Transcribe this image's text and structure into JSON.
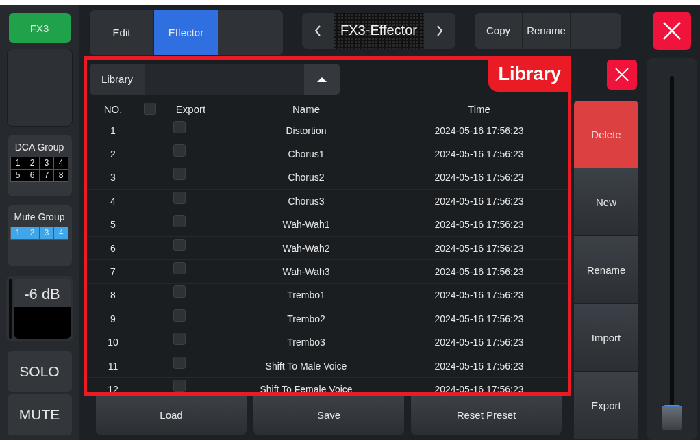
{
  "channel": {
    "label": "FX3"
  },
  "tabs": [
    {
      "label": "Edit",
      "selected": false
    },
    {
      "label": "Effector",
      "selected": true
    }
  ],
  "preset": {
    "title": "FX3-Effector"
  },
  "preset_actions": [
    "Copy",
    "Rename"
  ],
  "dca_group": {
    "title": "DCA Group",
    "cells": [
      {
        "label": "1",
        "on": false
      },
      {
        "label": "2",
        "on": false
      },
      {
        "label": "3",
        "on": false
      },
      {
        "label": "4",
        "on": false
      },
      {
        "label": "5",
        "on": false
      },
      {
        "label": "6",
        "on": false
      },
      {
        "label": "7",
        "on": false
      },
      {
        "label": "8",
        "on": false
      }
    ]
  },
  "mute_group": {
    "title": "Mute Group",
    "cells": [
      {
        "label": "1",
        "on": true
      },
      {
        "label": "2",
        "on": true
      },
      {
        "label": "3",
        "on": true
      },
      {
        "label": "4",
        "on": true
      }
    ]
  },
  "gain": {
    "reading": "-6 dB"
  },
  "solo": "SOLO",
  "mute": "MUTE",
  "library": {
    "title": "Library",
    "label": "Library",
    "columns": [
      "NO.",
      "Export",
      "Name",
      "Time"
    ],
    "select_all": false,
    "rows": [
      {
        "no": "1",
        "export": false,
        "name": "Distortion",
        "time": "2024-05-16 17:56:23"
      },
      {
        "no": "2",
        "export": false,
        "name": "Chorus1",
        "time": "2024-05-16 17:56:23"
      },
      {
        "no": "3",
        "export": false,
        "name": "Chorus2",
        "time": "2024-05-16 17:56:23"
      },
      {
        "no": "4",
        "export": false,
        "name": "Chorus3",
        "time": "2024-05-16 17:56:23"
      },
      {
        "no": "5",
        "export": false,
        "name": "Wah-Wah1",
        "time": "2024-05-16 17:56:23"
      },
      {
        "no": "6",
        "export": false,
        "name": "Wah-Wah2",
        "time": "2024-05-16 17:56:23"
      },
      {
        "no": "7",
        "export": false,
        "name": "Wah-Wah3",
        "time": "2024-05-16 17:56:23"
      },
      {
        "no": "8",
        "export": false,
        "name": "Trembo1",
        "time": "2024-05-16 17:56:23"
      },
      {
        "no": "9",
        "export": false,
        "name": "Trembo2",
        "time": "2024-05-16 17:56:23"
      },
      {
        "no": "10",
        "export": false,
        "name": "Trembo3",
        "time": "2024-05-16 17:56:23"
      },
      {
        "no": "11",
        "export": false,
        "name": "Shift To Male Voice",
        "time": "2024-05-16 17:56:23"
      },
      {
        "no": "12",
        "export": false,
        "name": "Shift To  Female Voice",
        "time": "2024-05-16 17:56:23"
      }
    ]
  },
  "library_buttons": [
    "Load",
    "Save",
    "Reset Preset"
  ],
  "side_actions": [
    {
      "label": "Delete",
      "kind": "danger"
    },
    {
      "label": "New",
      "kind": "normal"
    },
    {
      "label": "Rename",
      "kind": "normal"
    },
    {
      "label": "Import",
      "kind": "normal"
    },
    {
      "label": "Export",
      "kind": "normal"
    }
  ],
  "fader": {
    "level": 0
  }
}
